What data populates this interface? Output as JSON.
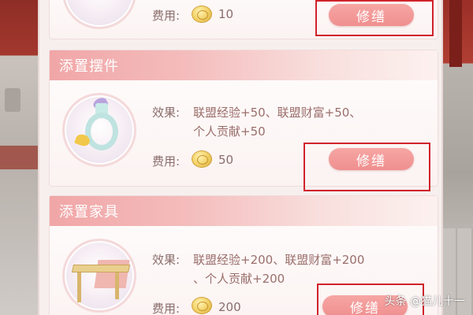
{
  "cards": [
    {
      "title": "",
      "cost_label": "费用:",
      "cost": "10",
      "button_label": "修缮"
    },
    {
      "title": "添置摆件",
      "effect_label": "效果:",
      "effect_line1": "联盟经验+50、联盟财富+50、",
      "effect_line2": "个人贡献+50",
      "cost_label": "费用:",
      "cost": "50",
      "button_label": "修缮"
    },
    {
      "title": "添置家具",
      "effect_label": "效果:",
      "effect_line1": "联盟经验+200、联盟财富+200",
      "effect_line2": "、个人贡献+200",
      "cost_label": "费用:",
      "cost": "200",
      "button_label": "修缮"
    }
  ],
  "watermark": "头条 @猫儿十一",
  "colors": {
    "accent_pink": "#ef8f8f",
    "highlight_red": "#d0232b",
    "header_pink": "#f1a6a7"
  }
}
